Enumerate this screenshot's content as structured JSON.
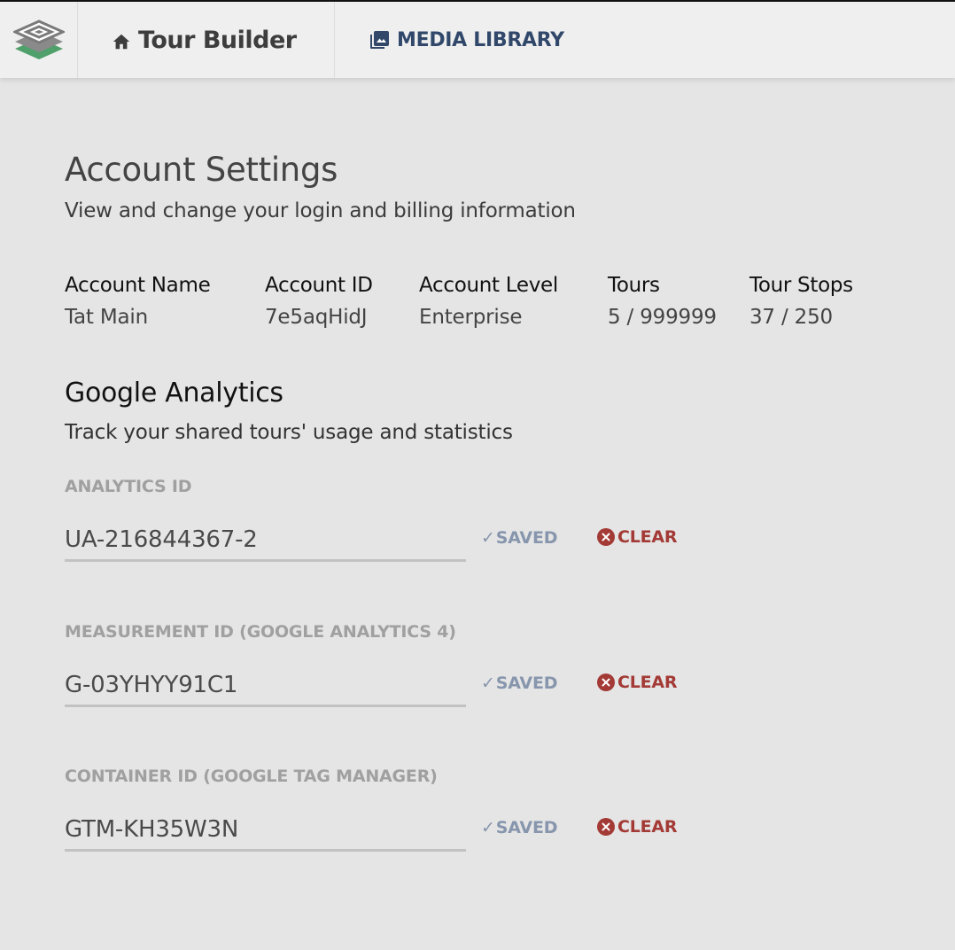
{
  "header": {
    "logo_icon": "stacked-layers-logo",
    "home_icon": "home-icon",
    "home_label": "Tour Builder",
    "media_icon": "image-gallery-icon",
    "media_label": "MEDIA LIBRARY"
  },
  "page": {
    "title": "Account Settings",
    "subtitle": "View and change your login and billing information"
  },
  "account": {
    "items": [
      {
        "label": "Account Name",
        "value": "Tat Main"
      },
      {
        "label": "Account ID",
        "value": "7e5aqHidJ"
      },
      {
        "label": "Account Level",
        "value": "Enterprise"
      },
      {
        "label": "Tours",
        "value": "5 / 999999"
      },
      {
        "label": "Tour Stops",
        "value": "37 / 250"
      }
    ]
  },
  "analytics": {
    "title": "Google Analytics",
    "subtitle": "Track your shared tours' usage and statistics",
    "fields": [
      {
        "label": "ANALYTICS ID",
        "value": "UA-216844367-2",
        "status": "SAVED",
        "clear_label": "CLEAR"
      },
      {
        "label": "MEASUREMENT ID (GOOGLE ANALYTICS 4)",
        "value": "G-03YHYY91C1",
        "status": "SAVED",
        "clear_label": "CLEAR"
      },
      {
        "label": "CONTAINER ID (GOOGLE TAG MANAGER)",
        "value": "GTM-KH35W3N",
        "status": "SAVED",
        "clear_label": "CLEAR"
      }
    ]
  },
  "colors": {
    "background": "#e5e5e5",
    "header_bg": "#efefef",
    "media_link": "#31486b",
    "saved": "#8796ad",
    "clear": "#a33a36",
    "logo_green": "#4fa06a"
  }
}
